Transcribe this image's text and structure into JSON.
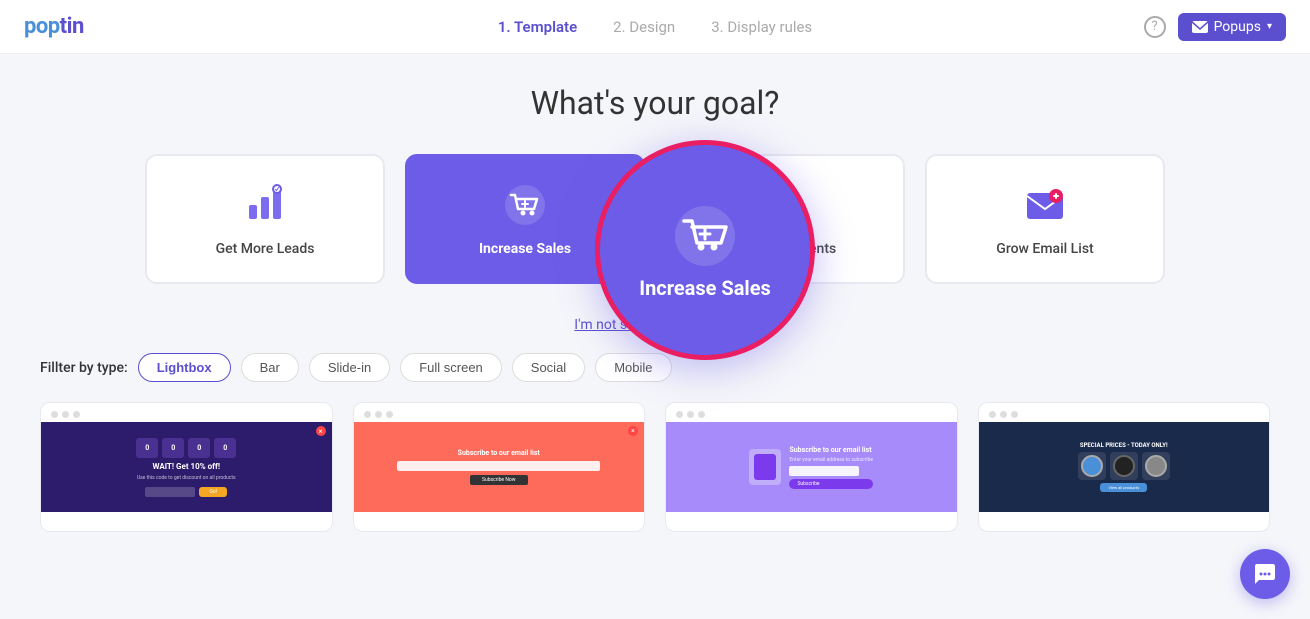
{
  "header": {
    "logo": "poptin",
    "steps": [
      {
        "number": "1",
        "label": "Template",
        "active": true
      },
      {
        "number": "2",
        "label": "Design",
        "active": false
      },
      {
        "number": "3",
        "label": "Display rules",
        "active": false
      }
    ],
    "help_tooltip": "?",
    "popups_label": "Popups",
    "popups_chevron": "▾"
  },
  "main": {
    "goal_title": "What's your goal?",
    "goal_cards": [
      {
        "id": "get-more-leads",
        "label": "Get More Leads",
        "icon": "bar-chart",
        "active": false
      },
      {
        "id": "increase-sales",
        "label": "Increase Sales",
        "icon": "cart",
        "active": true
      },
      {
        "id": "announcements",
        "label": "Announcements",
        "icon": "megaphone",
        "active": false
      },
      {
        "id": "grow-email-list",
        "label": "Grow Email List",
        "icon": "envelope",
        "active": false
      }
    ],
    "skip_text": "I'm not sure, skip this step",
    "filter_label": "Fillter by type:",
    "filter_buttons": [
      {
        "label": "Lightbox",
        "active": true
      },
      {
        "label": "Bar",
        "active": false
      },
      {
        "label": "Slide-in",
        "active": false
      },
      {
        "label": "Full screen",
        "active": false
      },
      {
        "label": "Social",
        "active": false
      },
      {
        "label": "Mobile",
        "active": false
      }
    ],
    "zoom_label": "Increase Sales"
  },
  "colors": {
    "purple": "#6c5ce7",
    "active_purple": "#5b4fcf",
    "pink": "#e91e63"
  }
}
